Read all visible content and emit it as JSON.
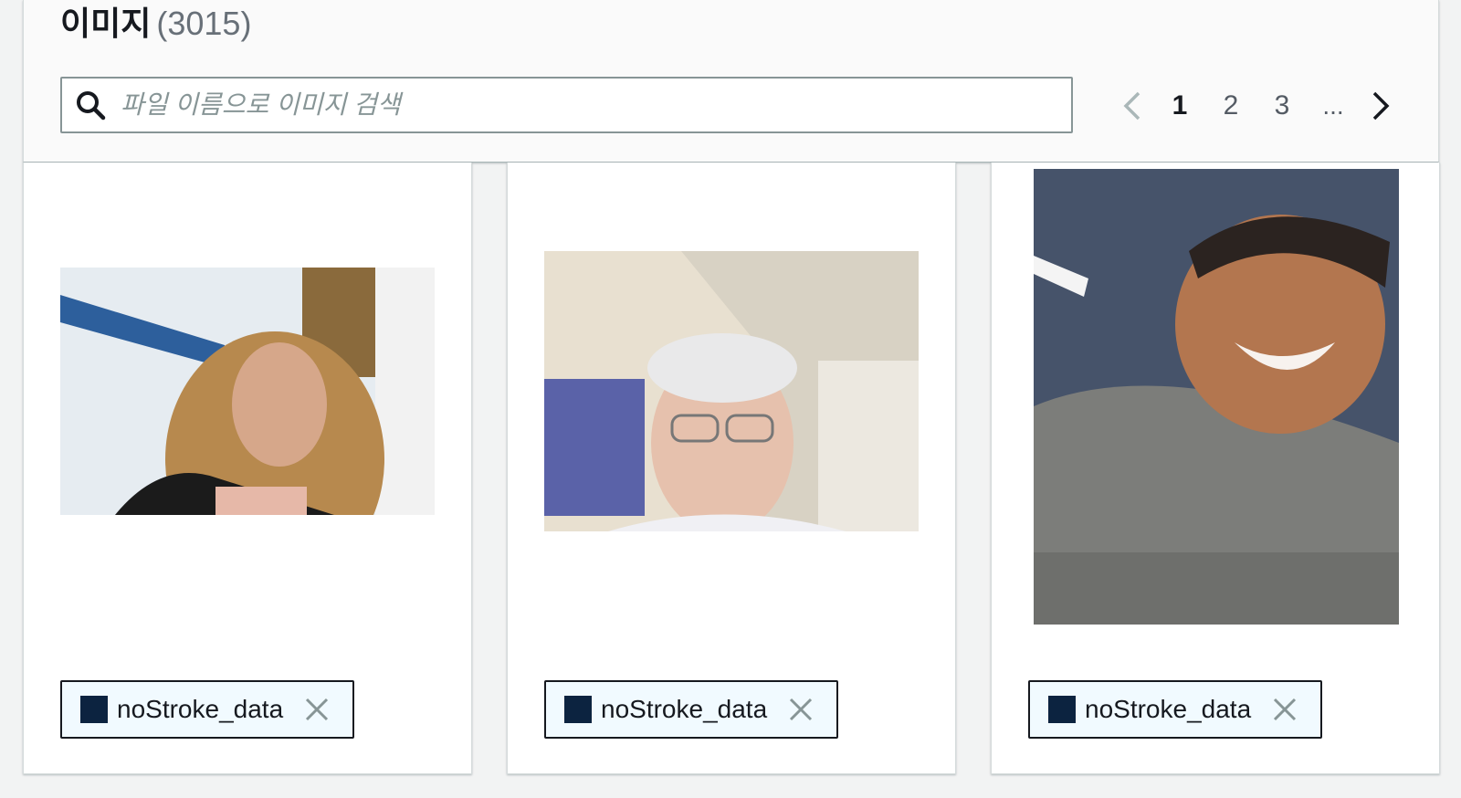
{
  "header": {
    "title": "이미지",
    "count": "(3015)"
  },
  "search": {
    "placeholder": "파일 이름으로 이미지 검색",
    "value": ""
  },
  "pagination": {
    "pages": [
      "1",
      "2",
      "3"
    ],
    "current_page": "1",
    "ellipsis": "..."
  },
  "cards": [
    {
      "tag_label": "noStroke_data",
      "tag_color": "#0c2340",
      "image": "woman-blonde-portrait"
    },
    {
      "tag_label": "noStroke_data",
      "tag_color": "#0c2340",
      "image": "older-man-selfie"
    },
    {
      "tag_label": "noStroke_data",
      "tag_color": "#0c2340",
      "image": "man-smiling-portrait"
    }
  ],
  "icons": {
    "search": "search-icon",
    "prev": "chevron-left-icon",
    "next": "chevron-right-icon",
    "remove_tag": "close-icon"
  }
}
